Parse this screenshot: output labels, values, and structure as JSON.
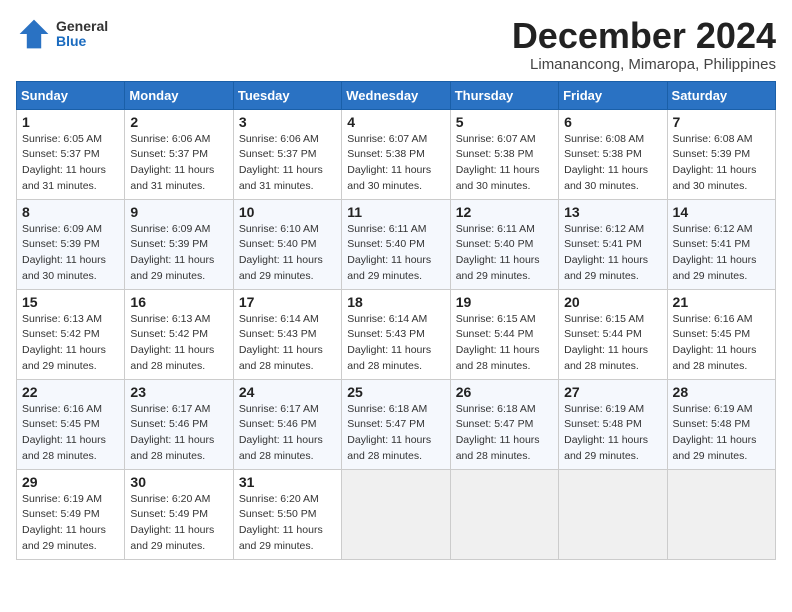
{
  "header": {
    "logo_general": "General",
    "logo_blue": "Blue",
    "month_title": "December 2024",
    "location": "Limanancong, Mimaropa, Philippines"
  },
  "weekdays": [
    "Sunday",
    "Monday",
    "Tuesday",
    "Wednesday",
    "Thursday",
    "Friday",
    "Saturday"
  ],
  "weeks": [
    [
      {
        "day": "1",
        "sunrise": "Sunrise: 6:05 AM",
        "sunset": "Sunset: 5:37 PM",
        "daylight": "Daylight: 11 hours and 31 minutes."
      },
      {
        "day": "2",
        "sunrise": "Sunrise: 6:06 AM",
        "sunset": "Sunset: 5:37 PM",
        "daylight": "Daylight: 11 hours and 31 minutes."
      },
      {
        "day": "3",
        "sunrise": "Sunrise: 6:06 AM",
        "sunset": "Sunset: 5:37 PM",
        "daylight": "Daylight: 11 hours and 31 minutes."
      },
      {
        "day": "4",
        "sunrise": "Sunrise: 6:07 AM",
        "sunset": "Sunset: 5:38 PM",
        "daylight": "Daylight: 11 hours and 30 minutes."
      },
      {
        "day": "5",
        "sunrise": "Sunrise: 6:07 AM",
        "sunset": "Sunset: 5:38 PM",
        "daylight": "Daylight: 11 hours and 30 minutes."
      },
      {
        "day": "6",
        "sunrise": "Sunrise: 6:08 AM",
        "sunset": "Sunset: 5:38 PM",
        "daylight": "Daylight: 11 hours and 30 minutes."
      },
      {
        "day": "7",
        "sunrise": "Sunrise: 6:08 AM",
        "sunset": "Sunset: 5:39 PM",
        "daylight": "Daylight: 11 hours and 30 minutes."
      }
    ],
    [
      {
        "day": "8",
        "sunrise": "Sunrise: 6:09 AM",
        "sunset": "Sunset: 5:39 PM",
        "daylight": "Daylight: 11 hours and 30 minutes."
      },
      {
        "day": "9",
        "sunrise": "Sunrise: 6:09 AM",
        "sunset": "Sunset: 5:39 PM",
        "daylight": "Daylight: 11 hours and 29 minutes."
      },
      {
        "day": "10",
        "sunrise": "Sunrise: 6:10 AM",
        "sunset": "Sunset: 5:40 PM",
        "daylight": "Daylight: 11 hours and 29 minutes."
      },
      {
        "day": "11",
        "sunrise": "Sunrise: 6:11 AM",
        "sunset": "Sunset: 5:40 PM",
        "daylight": "Daylight: 11 hours and 29 minutes."
      },
      {
        "day": "12",
        "sunrise": "Sunrise: 6:11 AM",
        "sunset": "Sunset: 5:40 PM",
        "daylight": "Daylight: 11 hours and 29 minutes."
      },
      {
        "day": "13",
        "sunrise": "Sunrise: 6:12 AM",
        "sunset": "Sunset: 5:41 PM",
        "daylight": "Daylight: 11 hours and 29 minutes."
      },
      {
        "day": "14",
        "sunrise": "Sunrise: 6:12 AM",
        "sunset": "Sunset: 5:41 PM",
        "daylight": "Daylight: 11 hours and 29 minutes."
      }
    ],
    [
      {
        "day": "15",
        "sunrise": "Sunrise: 6:13 AM",
        "sunset": "Sunset: 5:42 PM",
        "daylight": "Daylight: 11 hours and 29 minutes."
      },
      {
        "day": "16",
        "sunrise": "Sunrise: 6:13 AM",
        "sunset": "Sunset: 5:42 PM",
        "daylight": "Daylight: 11 hours and 28 minutes."
      },
      {
        "day": "17",
        "sunrise": "Sunrise: 6:14 AM",
        "sunset": "Sunset: 5:43 PM",
        "daylight": "Daylight: 11 hours and 28 minutes."
      },
      {
        "day": "18",
        "sunrise": "Sunrise: 6:14 AM",
        "sunset": "Sunset: 5:43 PM",
        "daylight": "Daylight: 11 hours and 28 minutes."
      },
      {
        "day": "19",
        "sunrise": "Sunrise: 6:15 AM",
        "sunset": "Sunset: 5:44 PM",
        "daylight": "Daylight: 11 hours and 28 minutes."
      },
      {
        "day": "20",
        "sunrise": "Sunrise: 6:15 AM",
        "sunset": "Sunset: 5:44 PM",
        "daylight": "Daylight: 11 hours and 28 minutes."
      },
      {
        "day": "21",
        "sunrise": "Sunrise: 6:16 AM",
        "sunset": "Sunset: 5:45 PM",
        "daylight": "Daylight: 11 hours and 28 minutes."
      }
    ],
    [
      {
        "day": "22",
        "sunrise": "Sunrise: 6:16 AM",
        "sunset": "Sunset: 5:45 PM",
        "daylight": "Daylight: 11 hours and 28 minutes."
      },
      {
        "day": "23",
        "sunrise": "Sunrise: 6:17 AM",
        "sunset": "Sunset: 5:46 PM",
        "daylight": "Daylight: 11 hours and 28 minutes."
      },
      {
        "day": "24",
        "sunrise": "Sunrise: 6:17 AM",
        "sunset": "Sunset: 5:46 PM",
        "daylight": "Daylight: 11 hours and 28 minutes."
      },
      {
        "day": "25",
        "sunrise": "Sunrise: 6:18 AM",
        "sunset": "Sunset: 5:47 PM",
        "daylight": "Daylight: 11 hours and 28 minutes."
      },
      {
        "day": "26",
        "sunrise": "Sunrise: 6:18 AM",
        "sunset": "Sunset: 5:47 PM",
        "daylight": "Daylight: 11 hours and 28 minutes."
      },
      {
        "day": "27",
        "sunrise": "Sunrise: 6:19 AM",
        "sunset": "Sunset: 5:48 PM",
        "daylight": "Daylight: 11 hours and 29 minutes."
      },
      {
        "day": "28",
        "sunrise": "Sunrise: 6:19 AM",
        "sunset": "Sunset: 5:48 PM",
        "daylight": "Daylight: 11 hours and 29 minutes."
      }
    ],
    [
      {
        "day": "29",
        "sunrise": "Sunrise: 6:19 AM",
        "sunset": "Sunset: 5:49 PM",
        "daylight": "Daylight: 11 hours and 29 minutes."
      },
      {
        "day": "30",
        "sunrise": "Sunrise: 6:20 AM",
        "sunset": "Sunset: 5:49 PM",
        "daylight": "Daylight: 11 hours and 29 minutes."
      },
      {
        "day": "31",
        "sunrise": "Sunrise: 6:20 AM",
        "sunset": "Sunset: 5:50 PM",
        "daylight": "Daylight: 11 hours and 29 minutes."
      },
      null,
      null,
      null,
      null
    ]
  ]
}
